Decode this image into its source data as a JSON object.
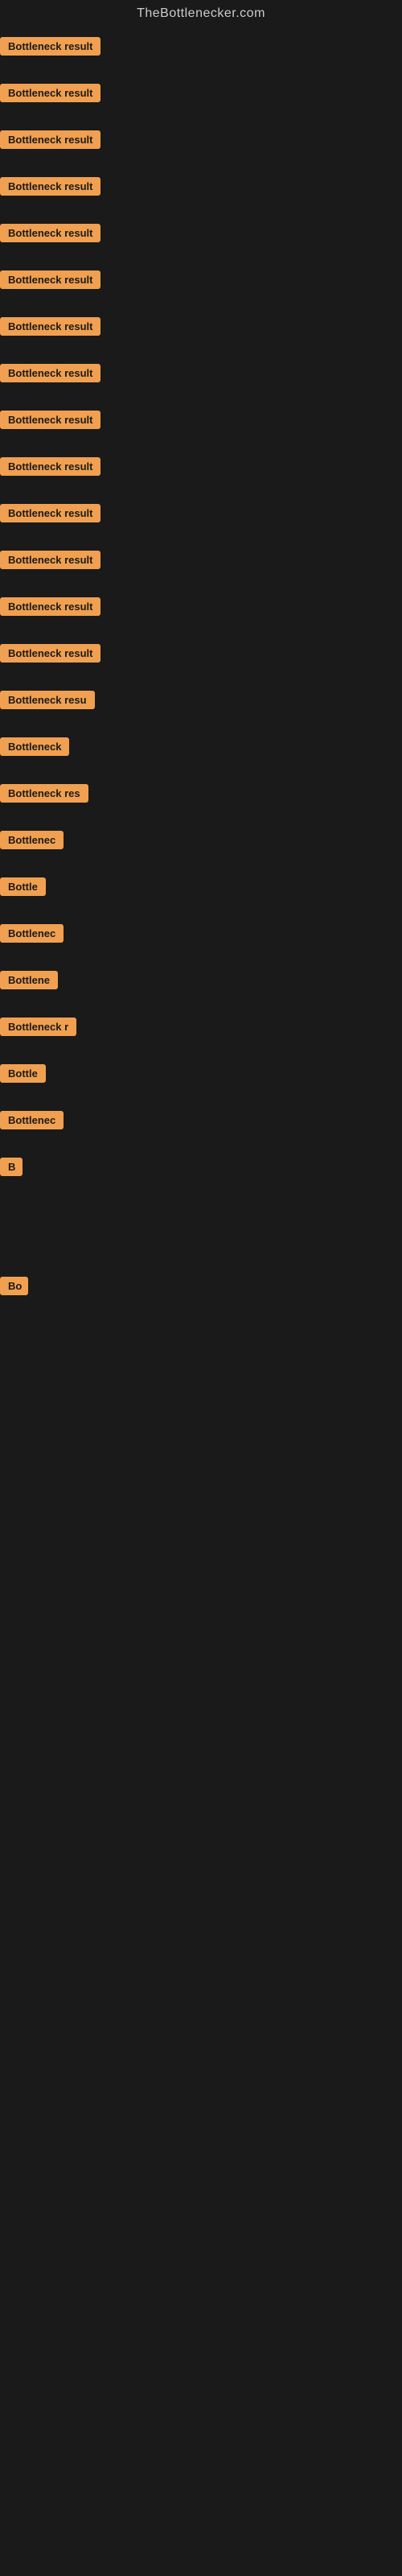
{
  "header": {
    "title": "TheBottlenecker.com"
  },
  "accent_color": "#f0a050",
  "items": [
    {
      "id": 1,
      "label": "Bottleneck result",
      "visible_chars": 16
    },
    {
      "id": 2,
      "label": "Bottleneck result",
      "visible_chars": 16
    },
    {
      "id": 3,
      "label": "Bottleneck result",
      "visible_chars": 16
    },
    {
      "id": 4,
      "label": "Bottleneck result",
      "visible_chars": 16
    },
    {
      "id": 5,
      "label": "Bottleneck result",
      "visible_chars": 16
    },
    {
      "id": 6,
      "label": "Bottleneck result",
      "visible_chars": 16
    },
    {
      "id": 7,
      "label": "Bottleneck result",
      "visible_chars": 16
    },
    {
      "id": 8,
      "label": "Bottleneck result",
      "visible_chars": 16
    },
    {
      "id": 9,
      "label": "Bottleneck result",
      "visible_chars": 16
    },
    {
      "id": 10,
      "label": "Bottleneck result",
      "visible_chars": 16
    },
    {
      "id": 11,
      "label": "Bottleneck result",
      "visible_chars": 16
    },
    {
      "id": 12,
      "label": "Bottleneck result",
      "visible_chars": 16
    },
    {
      "id": 13,
      "label": "Bottleneck result",
      "visible_chars": 16
    },
    {
      "id": 14,
      "label": "Bottleneck result",
      "visible_chars": 16
    },
    {
      "id": 15,
      "label": "Bottleneck resu",
      "visible_chars": 15
    },
    {
      "id": 16,
      "label": "Bottleneck",
      "visible_chars": 10
    },
    {
      "id": 17,
      "label": "Bottleneck res",
      "visible_chars": 14
    },
    {
      "id": 18,
      "label": "Bottlenec",
      "visible_chars": 9
    },
    {
      "id": 19,
      "label": "Bottle",
      "visible_chars": 6
    },
    {
      "id": 20,
      "label": "Bottlenec",
      "visible_chars": 9
    },
    {
      "id": 21,
      "label": "Bottlene",
      "visible_chars": 8
    },
    {
      "id": 22,
      "label": "Bottleneck r",
      "visible_chars": 12
    },
    {
      "id": 23,
      "label": "Bottle",
      "visible_chars": 6
    },
    {
      "id": 24,
      "label": "Bottlenec",
      "visible_chars": 9
    },
    {
      "id": 25,
      "label": "B",
      "visible_chars": 1
    },
    {
      "id": 26,
      "label": "",
      "visible_chars": 0
    },
    {
      "id": 27,
      "label": "",
      "visible_chars": 0
    },
    {
      "id": 28,
      "label": "",
      "visible_chars": 0
    },
    {
      "id": 29,
      "label": "Bo",
      "visible_chars": 2
    },
    {
      "id": 30,
      "label": "",
      "visible_chars": 0
    },
    {
      "id": 31,
      "label": "",
      "visible_chars": 0
    },
    {
      "id": 32,
      "label": "",
      "visible_chars": 0
    }
  ]
}
